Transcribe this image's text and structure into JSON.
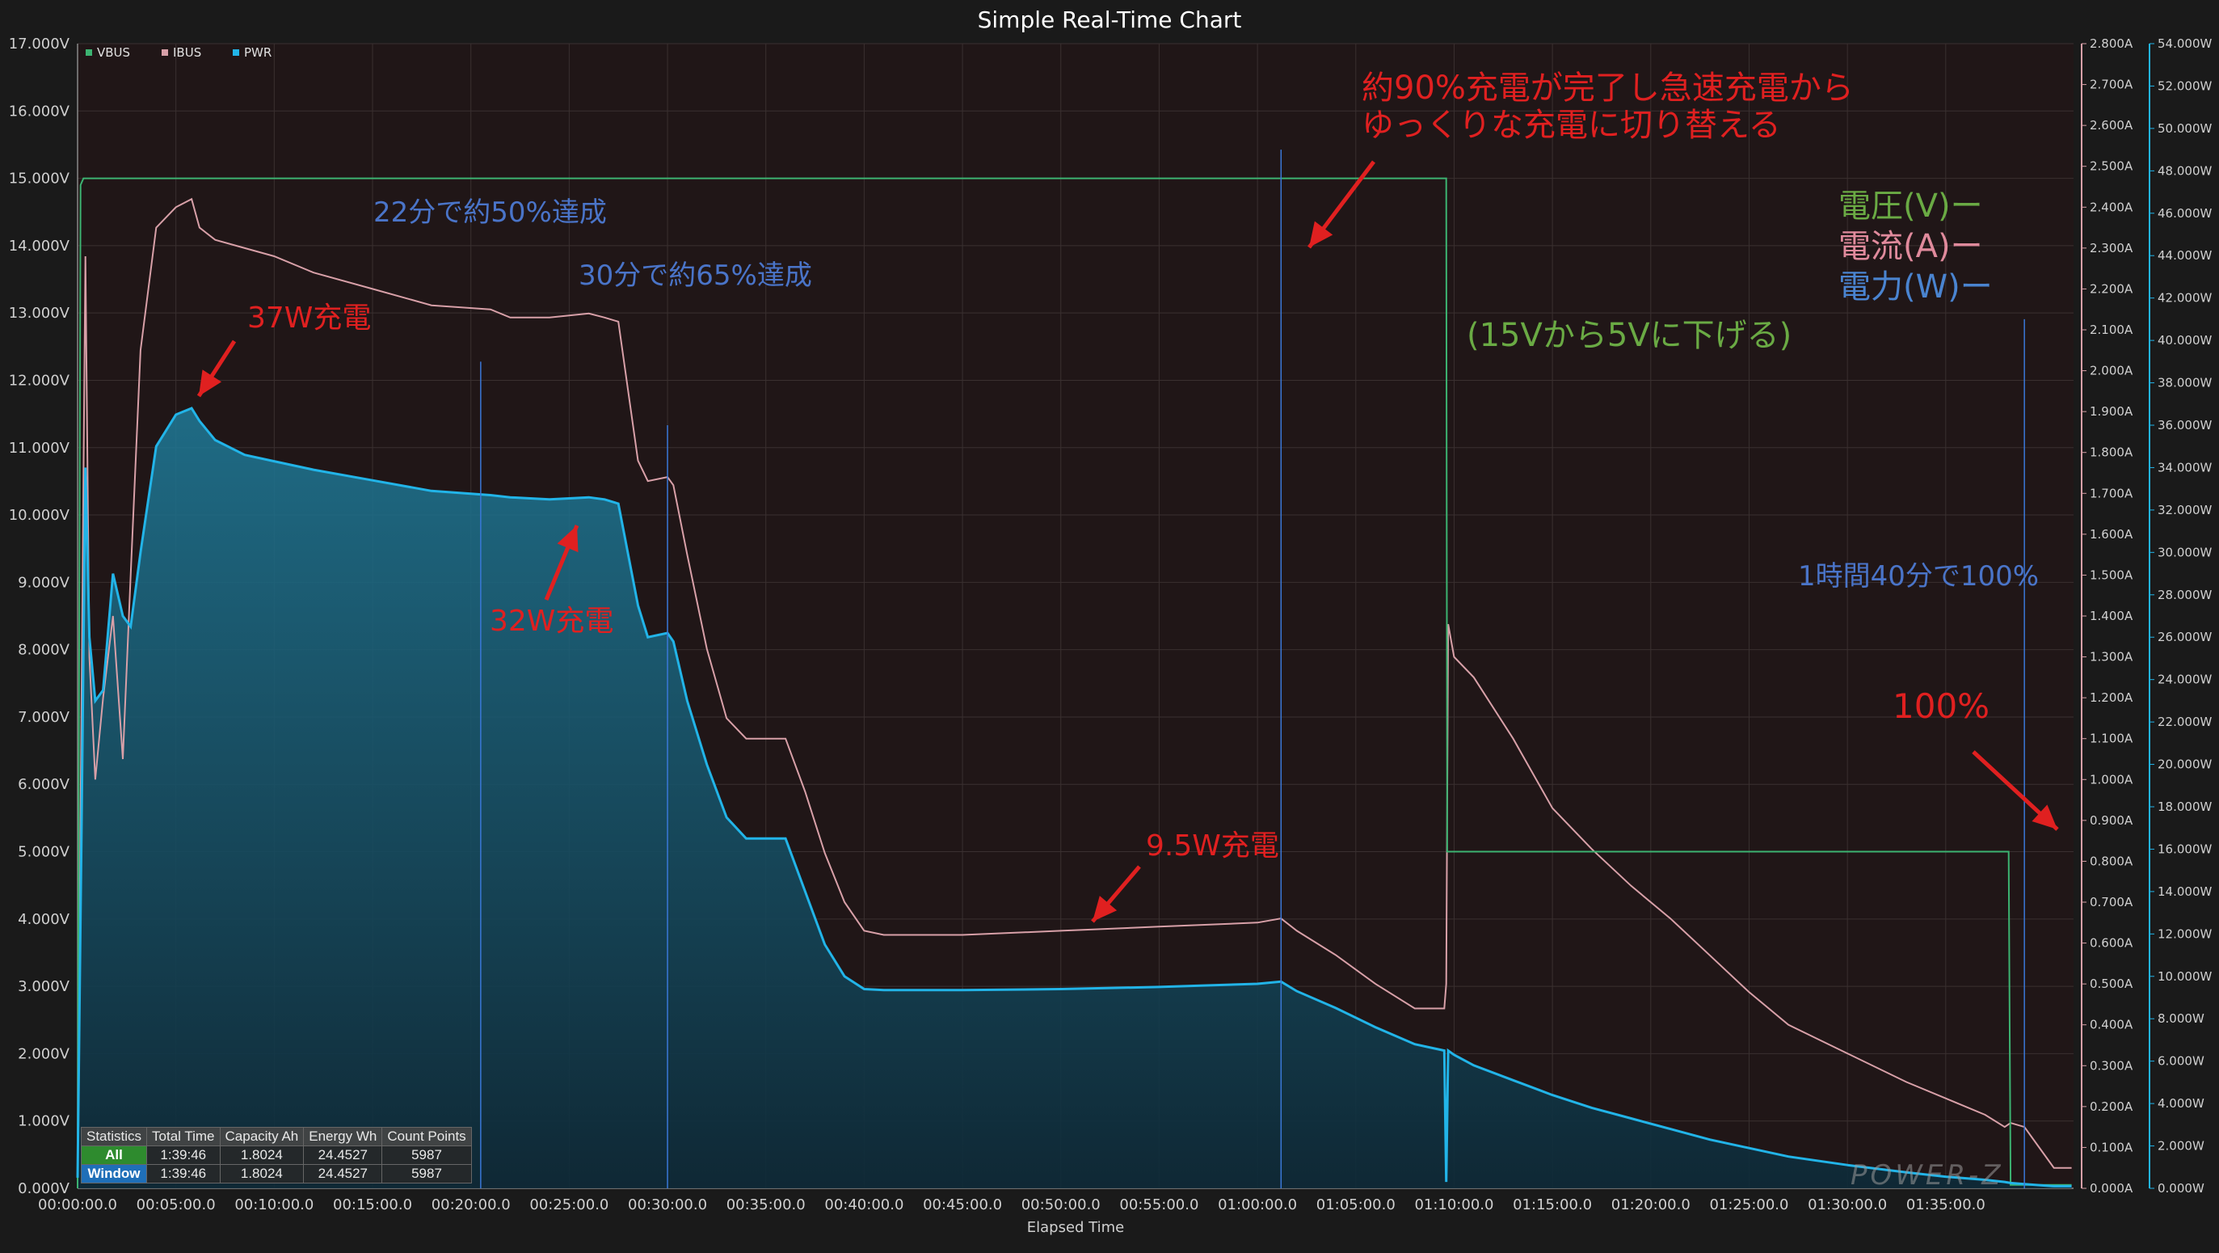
{
  "chart_data": {
    "type": "line",
    "title": "Simple Real-Time Chart",
    "xlabel": "Elapsed Time",
    "x_range_minutes": [
      0,
      101.5
    ],
    "x_ticks": [
      "00:00:00.0",
      "00:05:00.0",
      "00:10:00.0",
      "00:15:00.0",
      "00:20:00.0",
      "00:25:00.0",
      "00:30:00.0",
      "00:35:00.0",
      "00:40:00.0",
      "00:45:00.0",
      "00:50:00.0",
      "00:55:00.0",
      "01:00:00.0",
      "01:05:00.0",
      "01:10:00.0",
      "01:15:00.0",
      "01:20:00.0",
      "01:25:00.0",
      "01:30:00.0",
      "01:35:00.0"
    ],
    "y_left": {
      "label": "V",
      "range": [
        0,
        17
      ],
      "ticks": [
        "0.000V",
        "1.000V",
        "2.000V",
        "3.000V",
        "4.000V",
        "5.000V",
        "6.000V",
        "7.000V",
        "8.000V",
        "9.000V",
        "10.000V",
        "11.000V",
        "12.000V",
        "13.000V",
        "14.000V",
        "15.000V",
        "16.000V",
        "17.000V"
      ]
    },
    "y_right1": {
      "label": "A",
      "range": [
        0,
        2.8
      ],
      "ticks": [
        "0.000A",
        "0.100A",
        "0.200A",
        "0.300A",
        "0.400A",
        "0.500A",
        "0.600A",
        "0.700A",
        "0.800A",
        "0.900A",
        "1.000A",
        "1.100A",
        "1.200A",
        "1.300A",
        "1.400A",
        "1.500A",
        "1.600A",
        "1.700A",
        "1.800A",
        "1.900A",
        "2.000A",
        "2.100A",
        "2.200A",
        "2.300A",
        "2.400A",
        "2.500A",
        "2.600A",
        "2.700A",
        "2.800A"
      ]
    },
    "y_right2": {
      "label": "W",
      "range": [
        0,
        54
      ],
      "ticks": [
        "0.000W",
        "2.000W",
        "4.000W",
        "6.000W",
        "8.000W",
        "10.000W",
        "12.000W",
        "14.000W",
        "16.000W",
        "18.000W",
        "20.000W",
        "22.000W",
        "24.000W",
        "26.000W",
        "28.000W",
        "30.000W",
        "32.000W",
        "34.000W",
        "36.000W",
        "38.000W",
        "40.000W",
        "42.000W",
        "44.000W",
        "46.000W",
        "48.000W",
        "50.000W",
        "52.000W",
        "54.000W"
      ]
    },
    "legend_position": "top-left",
    "grid": true,
    "series": [
      {
        "name": "VBUS",
        "axis": "V",
        "color": "#3cb371",
        "x": [
          0,
          0.15,
          0.3,
          0.4,
          10,
          30,
          50,
          69.6,
          69.65,
          70,
          80,
          90,
          98.2,
          98.3,
          100,
          101.4
        ],
        "y": [
          0,
          14.9,
          15.0,
          15.0,
          15.0,
          15.0,
          15.0,
          15.0,
          5.0,
          5.0,
          5.0,
          5.0,
          5.0,
          0.05,
          0.05,
          0.05
        ]
      },
      {
        "name": "IBUS",
        "axis": "A",
        "color": "#d8a0a8",
        "x": [
          0,
          0.2,
          0.4,
          0.6,
          0.9,
          1.3,
          1.8,
          2.3,
          2.7,
          3.2,
          4.0,
          5.0,
          5.8,
          6.2,
          7.0,
          8.5,
          10.0,
          12.0,
          15.0,
          18.0,
          21.0,
          22.0,
          24.0,
          26.0,
          26.8,
          27.5,
          28.5,
          29.0,
          30.0,
          30.3,
          31.0,
          32.0,
          33.0,
          34.0,
          35.0,
          36.0,
          37.0,
          38.0,
          39.0,
          40.0,
          41.0,
          45.0,
          50.0,
          55.0,
          60.0,
          61.2,
          62.0,
          64.0,
          66.0,
          68.0,
          69.5,
          69.6,
          69.7,
          70.0,
          71.0,
          73.0,
          75.0,
          77.0,
          79.0,
          81.0,
          83.0,
          85.0,
          87.0,
          90.0,
          93.0,
          95.0,
          97.0,
          98.0,
          98.3,
          99.0,
          100.5,
          101.4
        ],
        "y": [
          0.05,
          1.2,
          2.28,
          1.3,
          1.0,
          1.2,
          1.4,
          1.05,
          1.5,
          2.05,
          2.35,
          2.4,
          2.42,
          2.35,
          2.32,
          2.3,
          2.28,
          2.24,
          2.2,
          2.16,
          2.15,
          2.13,
          2.13,
          2.14,
          2.13,
          2.12,
          1.78,
          1.73,
          1.74,
          1.72,
          1.55,
          1.32,
          1.15,
          1.1,
          1.1,
          1.1,
          0.97,
          0.82,
          0.7,
          0.63,
          0.62,
          0.62,
          0.63,
          0.64,
          0.65,
          0.66,
          0.63,
          0.57,
          0.5,
          0.44,
          0.44,
          0.5,
          1.38,
          1.3,
          1.25,
          1.1,
          0.93,
          0.83,
          0.74,
          0.66,
          0.57,
          0.48,
          0.4,
          0.33,
          0.26,
          0.22,
          0.18,
          0.15,
          0.16,
          0.15,
          0.05,
          0.05
        ]
      },
      {
        "name": "PWR",
        "axis": "W",
        "color": "#22b4e8",
        "x": [
          0,
          0.2,
          0.4,
          0.6,
          0.9,
          1.3,
          1.8,
          2.3,
          2.7,
          3.2,
          4.0,
          5.0,
          5.8,
          6.2,
          7.0,
          8.5,
          10.0,
          12.0,
          15.0,
          18.0,
          21.0,
          22.0,
          24.0,
          26.0,
          26.8,
          27.5,
          28.5,
          29.0,
          30.0,
          30.3,
          31.0,
          32.0,
          33.0,
          34.0,
          35.0,
          36.0,
          37.0,
          38.0,
          39.0,
          40.0,
          41.0,
          45.0,
          50.0,
          55.0,
          60.0,
          61.2,
          62.0,
          64.0,
          66.0,
          68.0,
          69.5,
          69.6,
          69.7,
          70.0,
          71.0,
          73.0,
          75.0,
          77.0,
          79.0,
          81.0,
          83.0,
          85.0,
          87.0,
          90.0,
          93.0,
          95.0,
          97.0,
          98.0,
          98.3,
          99.0,
          100.5,
          101.4
        ],
        "y": [
          0.5,
          17.0,
          34.0,
          26.0,
          23.0,
          23.5,
          29.0,
          27.0,
          26.5,
          30.0,
          35.0,
          36.5,
          36.8,
          36.2,
          35.3,
          34.6,
          34.3,
          33.9,
          33.4,
          32.9,
          32.7,
          32.6,
          32.5,
          32.6,
          32.5,
          32.3,
          27.5,
          26.0,
          26.2,
          25.8,
          23.0,
          20.0,
          17.5,
          16.5,
          16.5,
          16.5,
          14.0,
          11.5,
          10.0,
          9.4,
          9.35,
          9.35,
          9.4,
          9.5,
          9.65,
          9.75,
          9.3,
          8.5,
          7.6,
          6.8,
          6.5,
          0.3,
          6.5,
          6.3,
          5.8,
          5.1,
          4.4,
          3.8,
          3.3,
          2.8,
          2.3,
          1.9,
          1.5,
          1.1,
          0.75,
          0.55,
          0.4,
          0.3,
          0.25,
          0.2,
          0.1,
          0.1
        ]
      }
    ],
    "markers": [
      {
        "x": 20.5,
        "y_w": 39
      },
      {
        "x": 30.0,
        "y_w": 36
      },
      {
        "x": 61.2,
        "y_w": 49
      },
      {
        "x": 99.0,
        "y_w": 41
      }
    ],
    "annotations": [
      {
        "key": "a37",
        "text": "37W充電",
        "color": "#e02020",
        "size": 36
      },
      {
        "key": "a32",
        "text": "32W充電",
        "color": "#e02020",
        "size": 36
      },
      {
        "key": "a95",
        "text": "9.5W充電",
        "color": "#e02020",
        "size": 36
      },
      {
        "key": "a22",
        "text": "22分で約50%達成",
        "color": "#4a74c8",
        "size": 34
      },
      {
        "key": "a30",
        "text": "30分で約65%達成",
        "color": "#4a74c8",
        "size": 34
      },
      {
        "key": "a90a",
        "text": "約90%充電が完了し急速充電から",
        "color": "#e02020",
        "size": 40
      },
      {
        "key": "a90b",
        "text": "ゆっくりな充電に切り替える",
        "color": "#e02020",
        "size": 40
      },
      {
        "key": "a100",
        "text": "100%",
        "color": "#e02020",
        "size": 42
      },
      {
        "key": "a140",
        "text": "1時間40分で100%",
        "color": "#4a74c8",
        "size": 34
      },
      {
        "key": "aV",
        "text": "電圧(V)ー",
        "color": "#6aaa44",
        "size": 40
      },
      {
        "key": "aA",
        "text": "電流(A)ー",
        "color": "#e08a9c",
        "size": 40
      },
      {
        "key": "aW",
        "text": "電力(W)ー",
        "color": "#4a84d0",
        "size": 40
      },
      {
        "key": "a15",
        "text": "(15Vから5Vに下げる)",
        "color": "#6aaa44",
        "size": 40
      }
    ],
    "watermark": "POWER-Z"
  },
  "stats": {
    "headers": [
      "Statistics",
      "Total Time",
      "Capacity Ah",
      "Energy Wh",
      "Count Points"
    ],
    "rows": [
      {
        "label": "All",
        "total_time": "1:39:46",
        "capacity": "1.8024",
        "energy": "24.4527",
        "count": "5987"
      },
      {
        "label": "Window",
        "total_time": "1:39:46",
        "capacity": "1.8024",
        "energy": "24.4527",
        "count": "5987"
      }
    ]
  }
}
